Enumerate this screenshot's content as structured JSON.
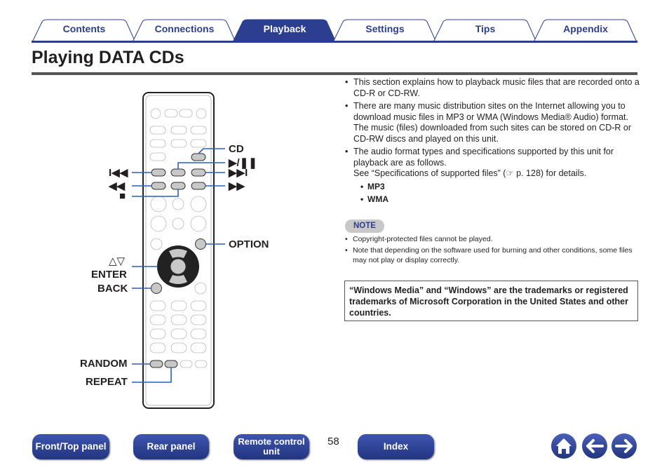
{
  "tabs": [
    {
      "label": "Contents"
    },
    {
      "label": "Connections"
    },
    {
      "label": "Playback",
      "active": true
    },
    {
      "label": "Settings"
    },
    {
      "label": "Tips"
    },
    {
      "label": "Appendix"
    }
  ],
  "title": "Playing DATA CDs",
  "remote_labels": {
    "cd": "CD",
    "play_pause": "▶/❚❚",
    "prev": "I◀◀",
    "next": "▶▶I",
    "rewind": "◀◀",
    "ff": "▶▶",
    "stop": "■",
    "option": "OPTION",
    "cursor": "△▽",
    "enter": "ENTER",
    "back": "BACK",
    "random": "RANDOM",
    "repeat": "REPEAT"
  },
  "content": {
    "b1": "This section explains how to playback music files that are recorded onto a CD-R or CD-RW.",
    "b2": "There are many music distribution sites on the Internet allowing you to download music files in MP3 or WMA (Windows Media® Audio) format. The music (files) downloaded from such sites can be stored on CD-R or CD-RW discs and played on this unit.",
    "b3a": "The audio format types and specifications supported by this unit for playback are as follows.",
    "b3b": "See “Specifications of supported files” (☞ p. 128) for details.",
    "formats": [
      "MP3",
      "WMA"
    ],
    "note_label": "NOTE",
    "notes": [
      "Copyright-protected files cannot be played.",
      "Note that depending on the software used for burning and other conditions, some files may not play or display correctly."
    ],
    "trademark": "“Windows Media” and “Windows” are the trademarks or registered trademarks of Microsoft Corporation in the United States and other countries."
  },
  "footer": {
    "front": "Front/Top panel",
    "rear": "Rear panel",
    "remote": "Remote control unit",
    "page": "58",
    "index": "Index"
  },
  "colors": {
    "accent": "#2b3e8f"
  }
}
